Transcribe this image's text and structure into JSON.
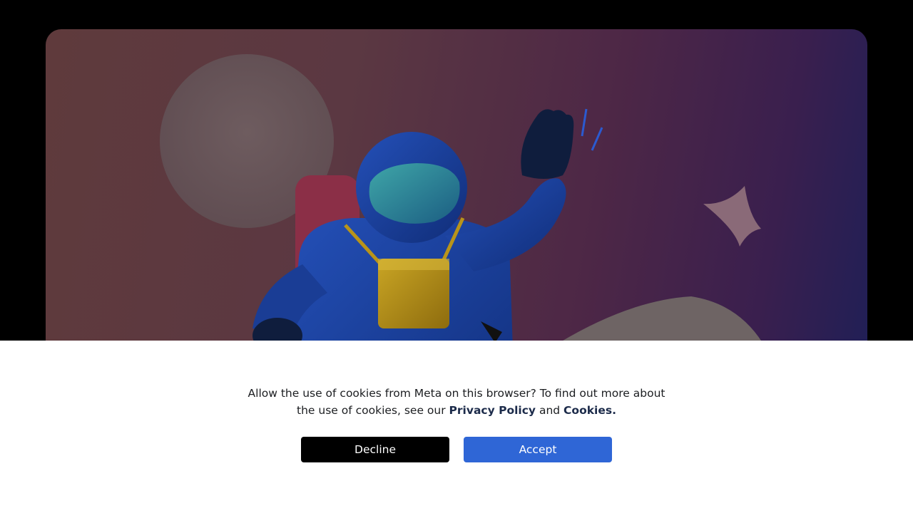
{
  "hero": {
    "image_description_icon": "astronaut-illustration",
    "colors": {
      "background_left": "#5f3a3c",
      "background_right": "#1d1f57",
      "moon": "#7a6668",
      "astronaut_suit": "#1d3f9a",
      "bag": "#b48f1a"
    }
  },
  "cookie_banner": {
    "text_before": "Allow the use of cookies from Meta on this browser? To find out more about the use of cookies, see our ",
    "privacy_link": "Privacy Policy",
    "text_middle": " and ",
    "cookies_link": "Cookies.",
    "decline_label": "Decline",
    "accept_label": "Accept",
    "colors": {
      "decline_bg": "#000000",
      "accept_bg": "#2f66d6",
      "link": "#1c2b4a"
    }
  }
}
